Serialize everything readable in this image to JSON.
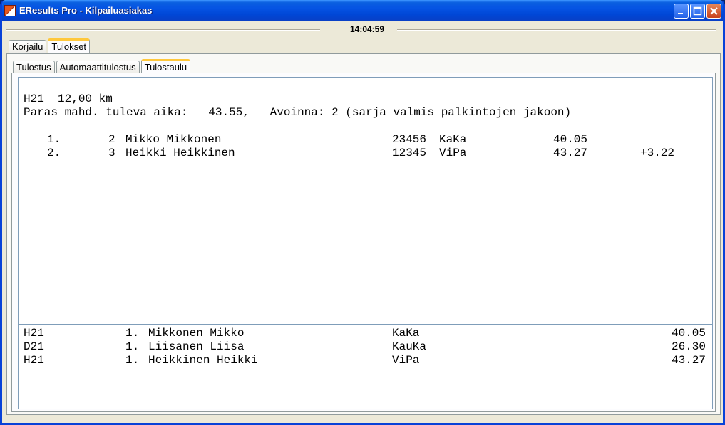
{
  "window": {
    "title": "EResults Pro - Kilpailuasiakas"
  },
  "clock": "14:04:59",
  "main_tabs": [
    "Korjailu",
    "Tulokset"
  ],
  "sub_tabs": [
    "Tulostus",
    "Automaattitulostus",
    "Tulostaulu"
  ],
  "board": {
    "header": {
      "class_line": "H21  12,00 km",
      "info_line": "Paras mahd. tuleva aika:   43.55,   Avoinna: 2 (sarja valmis palkintojen jakoon)"
    },
    "results": [
      {
        "pos": "1.",
        "bib": "2",
        "name": "Mikko Mikkonen",
        "emit": "23456",
        "club": "KaKa",
        "time": "40.05",
        "diff": ""
      },
      {
        "pos": "2.",
        "bib": "3",
        "name": "Heikki Heikkinen",
        "emit": "12345",
        "club": "ViPa",
        "time": "43.27",
        "diff": "+3.22"
      }
    ],
    "latest": [
      {
        "cls": "H21",
        "pos": "1.",
        "name": "Mikkonen Mikko",
        "club": "KaKa",
        "time": "40.05"
      },
      {
        "cls": "D21",
        "pos": "1.",
        "name": "Liisanen Liisa",
        "club": "KauKa",
        "time": "26.30"
      },
      {
        "cls": "H21",
        "pos": "1.",
        "name": "Heikkinen Heikki",
        "club": "ViPa",
        "time": "43.27"
      }
    ]
  },
  "colors": {
    "titlebar": "#0553e3",
    "active_tab_accent": "#ffc83c",
    "window_bg": "#ece9d8"
  }
}
